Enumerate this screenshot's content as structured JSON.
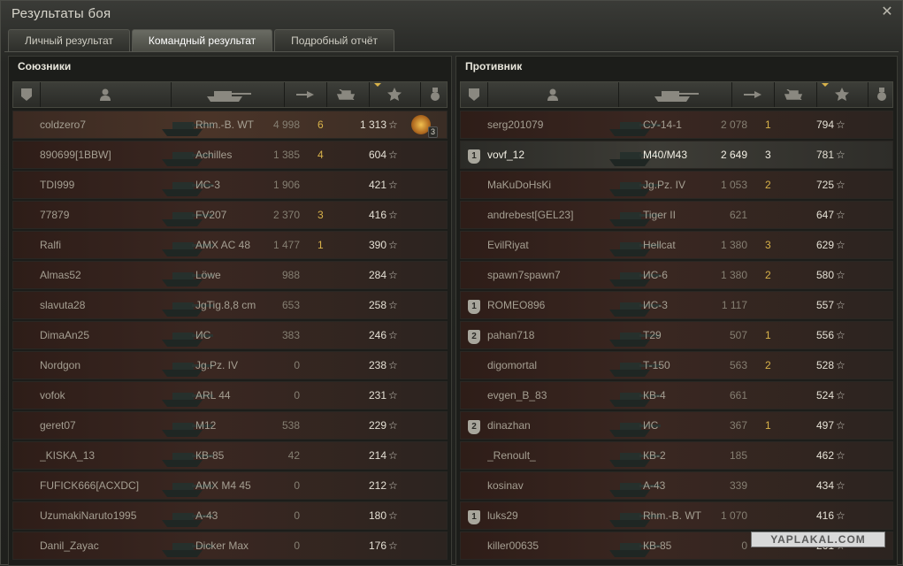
{
  "window": {
    "title": "Результаты боя"
  },
  "tabs": [
    {
      "label": "Личный результат",
      "active": false
    },
    {
      "label": "Командный результат",
      "active": true
    },
    {
      "label": "Подробный отчёт",
      "active": false
    }
  ],
  "allies": {
    "title": "Союзники",
    "rows": [
      {
        "name": "coldzero7",
        "tank": "Rhm.-B. WT",
        "damage": "4 998",
        "kills": "6",
        "exp": "1 313",
        "medal": "3",
        "highlight": true
      },
      {
        "name": "890699[1BBW]",
        "tank": "Achilles",
        "damage": "1 385",
        "kills": "4",
        "exp": "604"
      },
      {
        "name": "TDI999",
        "tank": "ИС-3",
        "damage": "1 906",
        "kills": "",
        "exp": "421"
      },
      {
        "name": "77879",
        "tank": "FV207",
        "damage": "2 370",
        "kills": "3",
        "exp": "416"
      },
      {
        "name": "Ralfi",
        "tank": "AMX AC 48",
        "damage": "1 477",
        "kills": "1",
        "exp": "390"
      },
      {
        "name": "Almas52",
        "tank": "Löwe",
        "damage": "988",
        "kills": "",
        "exp": "284"
      },
      {
        "name": "slavuta28",
        "tank": "JgTig.8,8 cm",
        "damage": "653",
        "kills": "",
        "exp": "258"
      },
      {
        "name": "DimaAn25",
        "tank": "ИС",
        "damage": "383",
        "kills": "",
        "exp": "246"
      },
      {
        "name": "Nordgon",
        "tank": "Jg.Pz. IV",
        "damage": "0",
        "kills": "",
        "exp": "238"
      },
      {
        "name": "vofok",
        "tank": "ARL 44",
        "damage": "0",
        "kills": "",
        "exp": "231"
      },
      {
        "name": "geret07",
        "tank": "M12",
        "damage": "538",
        "kills": "",
        "exp": "229"
      },
      {
        "name": "_KISKA_13",
        "tank": "КВ-85",
        "damage": "42",
        "kills": "",
        "exp": "214"
      },
      {
        "name": "FUFICK666[ACXDC]",
        "tank": "AMX M4 45",
        "damage": "0",
        "kills": "",
        "exp": "212"
      },
      {
        "name": "UzumakiNaruto1995",
        "tank": "А-43",
        "damage": "0",
        "kills": "",
        "exp": "180"
      },
      {
        "name": "Danil_Zayac",
        "tank": "Dicker Max",
        "damage": "0",
        "kills": "",
        "exp": "176"
      }
    ]
  },
  "enemies": {
    "title": "Противник",
    "rows": [
      {
        "name": "serg201079",
        "tank": "СУ-14-1",
        "damage": "2 078",
        "kills": "1",
        "exp": "794"
      },
      {
        "name": "vovf_12",
        "tank": "M40/M43",
        "damage": "2 649",
        "kills": "3",
        "exp": "781",
        "platoon": "1",
        "me": true
      },
      {
        "name": "MaKuDoHsKi",
        "tank": "Jg.Pz. IV",
        "damage": "1 053",
        "kills": "2",
        "exp": "725"
      },
      {
        "name": "andrebest[GEL23]",
        "tank": "Tiger II",
        "damage": "621",
        "kills": "",
        "exp": "647"
      },
      {
        "name": "EvilRiyat",
        "tank": "Hellcat",
        "damage": "1 380",
        "kills": "3",
        "exp": "629"
      },
      {
        "name": "spawn7spawn7",
        "tank": "ИС-6",
        "damage": "1 380",
        "kills": "2",
        "exp": "580"
      },
      {
        "name": "ROMEO896",
        "tank": "ИС-3",
        "damage": "1 117",
        "kills": "",
        "exp": "557",
        "platoon": "1"
      },
      {
        "name": "pahan718",
        "tank": "T29",
        "damage": "507",
        "kills": "1",
        "exp": "556",
        "platoon": "2"
      },
      {
        "name": "digomortal",
        "tank": "T-150",
        "damage": "563",
        "kills": "2",
        "exp": "528"
      },
      {
        "name": "evgen_B_83",
        "tank": "КВ-4",
        "damage": "661",
        "kills": "",
        "exp": "524"
      },
      {
        "name": "dinazhan",
        "tank": "ИС",
        "damage": "367",
        "kills": "1",
        "exp": "497",
        "platoon": "2"
      },
      {
        "name": "_Renoult_",
        "tank": "КВ-2",
        "damage": "185",
        "kills": "",
        "exp": "462"
      },
      {
        "name": "kosinav",
        "tank": "А-43",
        "damage": "339",
        "kills": "",
        "exp": "434"
      },
      {
        "name": "luks29",
        "tank": "Rhm.-B. WT",
        "damage": "1 070",
        "kills": "",
        "exp": "416",
        "platoon": "1"
      },
      {
        "name": "killer00635",
        "tank": "КВ-85",
        "damage": "0",
        "kills": "",
        "exp": "261"
      }
    ]
  },
  "star_glyph": "☆",
  "watermark": "YAPLAKAL.COM",
  "colors": {
    "accent": "#d8b24a",
    "text": "#a59f92",
    "row_bg": "#3a2721"
  }
}
